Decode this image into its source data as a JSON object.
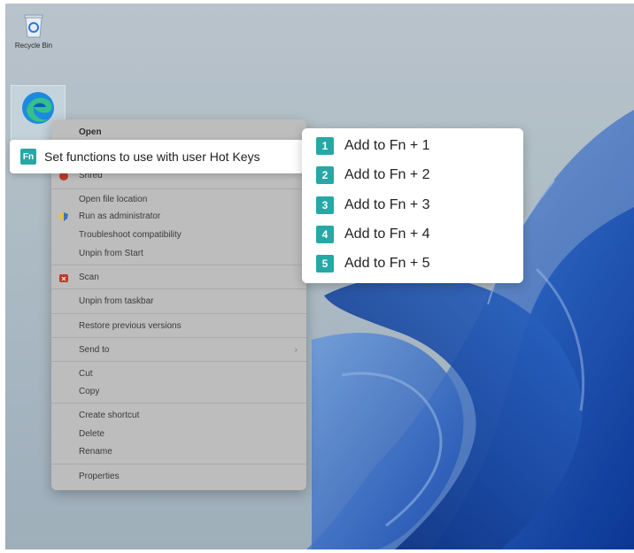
{
  "desktop": {
    "icons": [
      {
        "name": "recycle-bin",
        "label": "Recycle Bin"
      },
      {
        "name": "edge",
        "label": "Microsoft Edge"
      }
    ]
  },
  "context_menu": {
    "items": [
      {
        "label": "Open",
        "icon": null,
        "bold": true
      },
      {
        "label": "Set functions to use with user Hot Keys",
        "icon": "fn-badge-icon"
      },
      {
        "label": "Shred",
        "icon": "shred-icon"
      },
      {
        "label": "Open file location",
        "icon": null
      },
      {
        "label": "Run as administrator",
        "icon": "shield-icon"
      },
      {
        "label": "Troubleshoot compatibility",
        "icon": null
      },
      {
        "label": "Unpin from Start",
        "icon": null
      },
      {
        "label": "Scan",
        "icon": "antivirus-icon"
      },
      {
        "label": "Unpin from taskbar",
        "icon": null
      },
      {
        "label": "Restore previous versions",
        "icon": null
      },
      {
        "label": "Send to",
        "icon": null,
        "has_submenu": true
      },
      {
        "label": "Cut",
        "icon": null
      },
      {
        "label": "Copy",
        "icon": null
      },
      {
        "label": "Create shortcut",
        "icon": null
      },
      {
        "label": "Delete",
        "icon": null
      },
      {
        "label": "Rename",
        "icon": null
      },
      {
        "label": "Properties",
        "icon": null
      }
    ],
    "highlighted": {
      "badge": "Fn",
      "label": "Set functions to use with user Hot Keys"
    },
    "submenu_chevron": "›"
  },
  "submenu": {
    "items": [
      {
        "num": "1",
        "label": "Add to Fn + 1"
      },
      {
        "num": "2",
        "label": "Add to Fn + 2"
      },
      {
        "num": "3",
        "label": "Add to Fn + 3"
      },
      {
        "num": "4",
        "label": "Add to Fn + 4"
      },
      {
        "num": "5",
        "label": "Add to Fn + 5"
      }
    ]
  },
  "colors": {
    "accent": "#25a8a6",
    "menu_bg": "#bdbdbd",
    "popup_bg": "#ffffff",
    "wallpaper_blue": "#1f5fc4"
  }
}
